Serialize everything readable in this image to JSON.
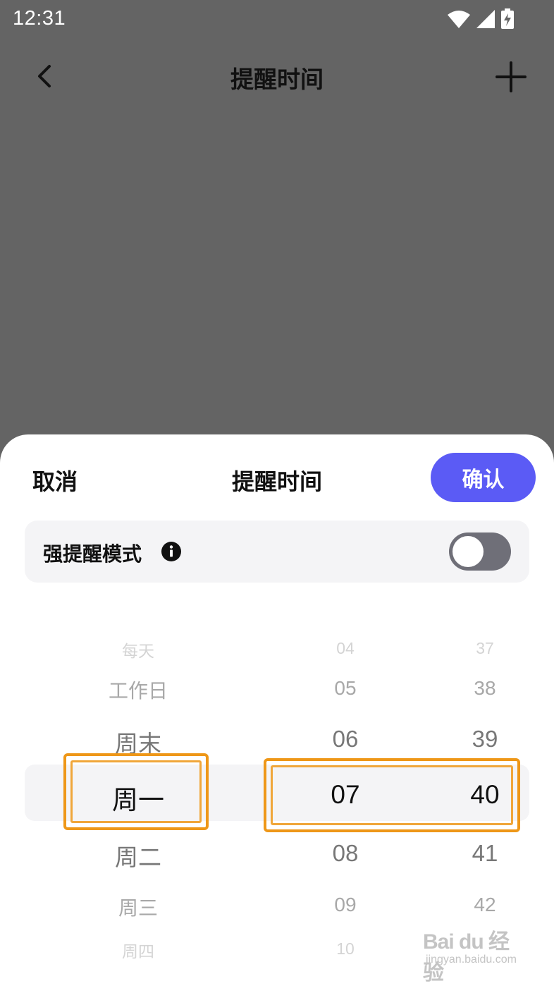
{
  "status_bar": {
    "time": "12:31"
  },
  "nav": {
    "title": "提醒时间"
  },
  "sheet": {
    "cancel_label": "取消",
    "title": "提醒时间",
    "confirm_label": "确认",
    "strong_reminder": {
      "label": "强提醒模式",
      "enabled": false
    }
  },
  "picker": {
    "days": [
      "每天",
      "工作日",
      "周末",
      "周一",
      "周二",
      "周三",
      "周四"
    ],
    "hours": [
      "04",
      "05",
      "06",
      "07",
      "08",
      "09",
      "10"
    ],
    "minutes": [
      "37",
      "38",
      "39",
      "40",
      "41",
      "42",
      ""
    ],
    "selected": {
      "day": "周一",
      "hour": "07",
      "minute": "40"
    }
  },
  "colors": {
    "accent": "#5b5bf5",
    "overlay": "#646464",
    "highlight_annotation": "#ee9718",
    "toggle_off": "#6f6f78"
  },
  "watermark": {
    "brand": "Bai du 经验",
    "site": "jingyan.baidu.com"
  }
}
